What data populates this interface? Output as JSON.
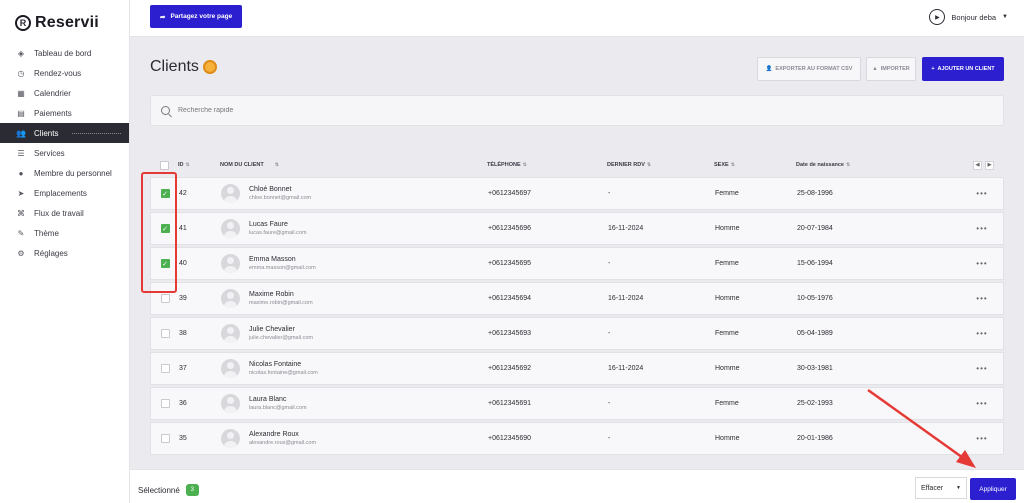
{
  "brand": {
    "name": "Reservii",
    "logo_letter": "R"
  },
  "sidebar": {
    "items": [
      {
        "label": "Tableau de bord",
        "icon": "dashboard-icon"
      },
      {
        "label": "Rendez-vous",
        "icon": "clock-icon"
      },
      {
        "label": "Calendrier",
        "icon": "calendar-icon"
      },
      {
        "label": "Paiements",
        "icon": "receipt-icon"
      },
      {
        "label": "Clients",
        "icon": "users-icon",
        "active": true
      },
      {
        "label": "Services",
        "icon": "list-icon"
      },
      {
        "label": "Membre du personnel",
        "icon": "user-icon"
      },
      {
        "label": "Emplacements",
        "icon": "location-arrow-icon"
      },
      {
        "label": "Flux de travail",
        "icon": "workflow-icon"
      },
      {
        "label": "Thème",
        "icon": "brush-icon"
      },
      {
        "label": "Réglages",
        "icon": "gear-icon"
      }
    ]
  },
  "topbar": {
    "share_label": "Partagez votre page",
    "user_greeting": "Bonjour deba"
  },
  "page": {
    "title": "Clients",
    "export_label": "EXPORTER AU FORMAT CSV",
    "import_label": "IMPORTER",
    "add_label": "AJOUTER UN CLIENT"
  },
  "search": {
    "placeholder": "Recherche rapide"
  },
  "table": {
    "headers": {
      "id": "ID",
      "client": "NOM DU CLIENT",
      "phone": "TÉLÉPHONE",
      "last_rdv": "DERNIER RDV",
      "sexe": "SEXE",
      "dob": "Date de naissance"
    },
    "rows": [
      {
        "checked": true,
        "id": "42",
        "name": "Chloé Bonnet",
        "email": "chloe.bonnet@gmail.com",
        "phone": "+0612345697",
        "last_rdv": "-",
        "sexe": "Femme",
        "dob": "25-08-1996"
      },
      {
        "checked": true,
        "id": "41",
        "name": "Lucas Faure",
        "email": "lucas.faure@gmail.com",
        "phone": "+0612345696",
        "last_rdv": "16-11-2024",
        "sexe": "Homme",
        "dob": "20-07-1984"
      },
      {
        "checked": true,
        "id": "40",
        "name": "Emma Masson",
        "email": "emma.masson@gmail.com",
        "phone": "+0612345695",
        "last_rdv": "-",
        "sexe": "Femme",
        "dob": "15-06-1994"
      },
      {
        "checked": false,
        "id": "39",
        "name": "Maxime Robin",
        "email": "maxime.robin@gmail.com",
        "phone": "+0612345694",
        "last_rdv": "16-11-2024",
        "sexe": "Homme",
        "dob": "10-05-1976"
      },
      {
        "checked": false,
        "id": "38",
        "name": "Julie Chevalier",
        "email": "julie.chevalier@gmail.com",
        "phone": "+0612345693",
        "last_rdv": "-",
        "sexe": "Femme",
        "dob": "05-04-1989"
      },
      {
        "checked": false,
        "id": "37",
        "name": "Nicolas Fontaine",
        "email": "nicolas.fontaine@gmail.com",
        "phone": "+0612345692",
        "last_rdv": "16-11-2024",
        "sexe": "Homme",
        "dob": "30-03-1981"
      },
      {
        "checked": false,
        "id": "36",
        "name": "Laura Blanc",
        "email": "laura.blanc@gmail.com",
        "phone": "+0612345691",
        "last_rdv": "-",
        "sexe": "Femme",
        "dob": "25-02-1993"
      },
      {
        "checked": false,
        "id": "35",
        "name": "Alexandre Roux",
        "email": "alexandre.roux@gmail.com",
        "phone": "+0612345690",
        "last_rdv": "-",
        "sexe": "Homme",
        "dob": "20-01-1986"
      }
    ],
    "more_glyph": "•••"
  },
  "bottombar": {
    "selected_label": "Sélectionné",
    "selected_count": "3",
    "action_value": "Effacer",
    "apply_label": "Appliquer"
  },
  "colors": {
    "accent": "#2b1fd0",
    "check": "#4caf50",
    "annotation": "#e53935"
  }
}
